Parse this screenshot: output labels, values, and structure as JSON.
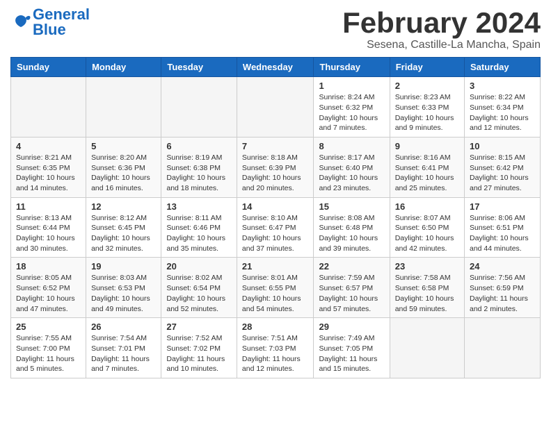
{
  "header": {
    "logo_line1": "General",
    "logo_line2": "Blue",
    "month": "February 2024",
    "location": "Sesena, Castille-La Mancha, Spain"
  },
  "weekdays": [
    "Sunday",
    "Monday",
    "Tuesday",
    "Wednesday",
    "Thursday",
    "Friday",
    "Saturday"
  ],
  "weeks": [
    [
      {
        "day": "",
        "info": ""
      },
      {
        "day": "",
        "info": ""
      },
      {
        "day": "",
        "info": ""
      },
      {
        "day": "",
        "info": ""
      },
      {
        "day": "1",
        "info": "Sunrise: 8:24 AM\nSunset: 6:32 PM\nDaylight: 10 hours\nand 7 minutes."
      },
      {
        "day": "2",
        "info": "Sunrise: 8:23 AM\nSunset: 6:33 PM\nDaylight: 10 hours\nand 9 minutes."
      },
      {
        "day": "3",
        "info": "Sunrise: 8:22 AM\nSunset: 6:34 PM\nDaylight: 10 hours\nand 12 minutes."
      }
    ],
    [
      {
        "day": "4",
        "info": "Sunrise: 8:21 AM\nSunset: 6:35 PM\nDaylight: 10 hours\nand 14 minutes."
      },
      {
        "day": "5",
        "info": "Sunrise: 8:20 AM\nSunset: 6:36 PM\nDaylight: 10 hours\nand 16 minutes."
      },
      {
        "day": "6",
        "info": "Sunrise: 8:19 AM\nSunset: 6:38 PM\nDaylight: 10 hours\nand 18 minutes."
      },
      {
        "day": "7",
        "info": "Sunrise: 8:18 AM\nSunset: 6:39 PM\nDaylight: 10 hours\nand 20 minutes."
      },
      {
        "day": "8",
        "info": "Sunrise: 8:17 AM\nSunset: 6:40 PM\nDaylight: 10 hours\nand 23 minutes."
      },
      {
        "day": "9",
        "info": "Sunrise: 8:16 AM\nSunset: 6:41 PM\nDaylight: 10 hours\nand 25 minutes."
      },
      {
        "day": "10",
        "info": "Sunrise: 8:15 AM\nSunset: 6:42 PM\nDaylight: 10 hours\nand 27 minutes."
      }
    ],
    [
      {
        "day": "11",
        "info": "Sunrise: 8:13 AM\nSunset: 6:44 PM\nDaylight: 10 hours\nand 30 minutes."
      },
      {
        "day": "12",
        "info": "Sunrise: 8:12 AM\nSunset: 6:45 PM\nDaylight: 10 hours\nand 32 minutes."
      },
      {
        "day": "13",
        "info": "Sunrise: 8:11 AM\nSunset: 6:46 PM\nDaylight: 10 hours\nand 35 minutes."
      },
      {
        "day": "14",
        "info": "Sunrise: 8:10 AM\nSunset: 6:47 PM\nDaylight: 10 hours\nand 37 minutes."
      },
      {
        "day": "15",
        "info": "Sunrise: 8:08 AM\nSunset: 6:48 PM\nDaylight: 10 hours\nand 39 minutes."
      },
      {
        "day": "16",
        "info": "Sunrise: 8:07 AM\nSunset: 6:50 PM\nDaylight: 10 hours\nand 42 minutes."
      },
      {
        "day": "17",
        "info": "Sunrise: 8:06 AM\nSunset: 6:51 PM\nDaylight: 10 hours\nand 44 minutes."
      }
    ],
    [
      {
        "day": "18",
        "info": "Sunrise: 8:05 AM\nSunset: 6:52 PM\nDaylight: 10 hours\nand 47 minutes."
      },
      {
        "day": "19",
        "info": "Sunrise: 8:03 AM\nSunset: 6:53 PM\nDaylight: 10 hours\nand 49 minutes."
      },
      {
        "day": "20",
        "info": "Sunrise: 8:02 AM\nSunset: 6:54 PM\nDaylight: 10 hours\nand 52 minutes."
      },
      {
        "day": "21",
        "info": "Sunrise: 8:01 AM\nSunset: 6:55 PM\nDaylight: 10 hours\nand 54 minutes."
      },
      {
        "day": "22",
        "info": "Sunrise: 7:59 AM\nSunset: 6:57 PM\nDaylight: 10 hours\nand 57 minutes."
      },
      {
        "day": "23",
        "info": "Sunrise: 7:58 AM\nSunset: 6:58 PM\nDaylight: 10 hours\nand 59 minutes."
      },
      {
        "day": "24",
        "info": "Sunrise: 7:56 AM\nSunset: 6:59 PM\nDaylight: 11 hours\nand 2 minutes."
      }
    ],
    [
      {
        "day": "25",
        "info": "Sunrise: 7:55 AM\nSunset: 7:00 PM\nDaylight: 11 hours\nand 5 minutes."
      },
      {
        "day": "26",
        "info": "Sunrise: 7:54 AM\nSunset: 7:01 PM\nDaylight: 11 hours\nand 7 minutes."
      },
      {
        "day": "27",
        "info": "Sunrise: 7:52 AM\nSunset: 7:02 PM\nDaylight: 11 hours\nand 10 minutes."
      },
      {
        "day": "28",
        "info": "Sunrise: 7:51 AM\nSunset: 7:03 PM\nDaylight: 11 hours\nand 12 minutes."
      },
      {
        "day": "29",
        "info": "Sunrise: 7:49 AM\nSunset: 7:05 PM\nDaylight: 11 hours\nand 15 minutes."
      },
      {
        "day": "",
        "info": ""
      },
      {
        "day": "",
        "info": ""
      }
    ]
  ]
}
